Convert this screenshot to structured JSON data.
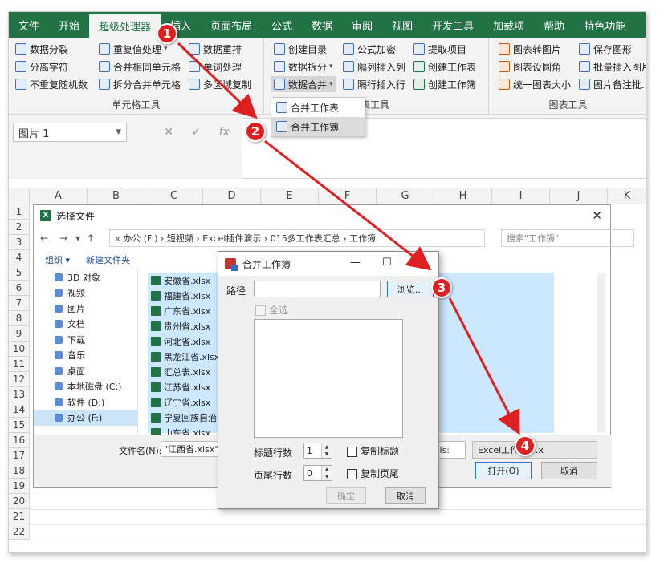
{
  "ribbon_tabs": [
    "文件",
    "开始",
    "超级处理器",
    "插入",
    "页面布局",
    "公式",
    "数据",
    "审阅",
    "视图",
    "开发工具",
    "加载项",
    "帮助",
    "特色功能"
  ],
  "ribbon": {
    "group1": {
      "items": [
        "数据分裂",
        "重复值处理",
        "数据重排",
        "分离字符",
        "合并相同单元格",
        "单词处理",
        "不重复随机数",
        "拆分合并单元格",
        "多区域复制"
      ],
      "label": "单元格工具"
    },
    "group2": {
      "items": [
        "创建目录",
        "公式加密",
        "提取项目",
        "数据拆分",
        "隔列插入列",
        "创建工作表",
        "数据合并",
        "隔行插入行",
        "创建工作簿"
      ],
      "label": "工作表工具",
      "label_visible": "表工具"
    },
    "group3": {
      "items": [
        "图表转图片",
        "保存图形",
        "图表设圆角",
        "批量插入图片",
        "统一图表大小",
        "图片备注批..."
      ],
      "label": "图表工具"
    }
  },
  "dropdown_menu": [
    "合并工作表",
    "合并工作簿"
  ],
  "name_box": "图片 1",
  "formula_icons": {
    "cancel": "✕",
    "enter": "✓",
    "fx": "fx"
  },
  "columns": [
    "A",
    "B",
    "C",
    "D",
    "E",
    "F",
    "G",
    "H",
    "I",
    "J",
    "K"
  ],
  "rows": [
    "1",
    "2",
    "3",
    "4",
    "5",
    "6",
    "7",
    "8",
    "9",
    "10",
    "11",
    "12",
    "13",
    "14",
    "15",
    "16",
    "17",
    "18",
    "19",
    "20",
    "21",
    "22"
  ],
  "file_dialog": {
    "title": "选择文件",
    "path": "«  办公 (F:)  ›  短视频  ›  Excel插件演示  ›  015多工作表汇总  ›  工作簿",
    "search_placeholder": "搜索\"工作簿\"",
    "organize": "组织 ▾",
    "new_folder": "新建文件夹",
    "sidebar": [
      "3D 对象",
      "视频",
      "图片",
      "文档",
      "下载",
      "音乐",
      "桌面",
      "本地磁盘 (C:)",
      "软件 (D:)",
      "办公 (F:)",
      "影视 (G:)"
    ],
    "files": [
      "安徽省.xlsx",
      "福建省.xlsx",
      "广东省.xlsx",
      "贵州省.xlsx",
      "河北省.xlsx",
      "黑龙江省.xlsx",
      "汇总表.xlsx",
      "江苏省.xlsx",
      "辽宁省.xlsx",
      "宁夏回族自治区",
      "山东省.xlsx"
    ],
    "filename_label": "文件名(N):",
    "filename_value": "\"江西省.xlsx\" \"辽",
    "type_partial": "xls:",
    "type_value": "Excel工作簿(*.x",
    "tools_label": ")",
    "open_button": "打开(O)",
    "cancel_button": "取消"
  },
  "merge_dialog": {
    "title": "合并工作簿",
    "path_label": "路径",
    "path_value": "",
    "browse_button": "浏览...",
    "select_all": "全选",
    "header_rows_label": "标题行数",
    "header_rows_value": "1",
    "copy_header": "复制标题",
    "footer_rows_label": "页尾行数",
    "footer_rows_value": "0",
    "copy_footer": "复制页尾",
    "ok_button": "确定",
    "cancel_button": "取消"
  },
  "callouts": [
    "1",
    "2",
    "3",
    "4"
  ],
  "colors": {
    "excel_green": "#217346",
    "arrow_red": "#e02020",
    "selection_blue": "#cce8ff"
  }
}
